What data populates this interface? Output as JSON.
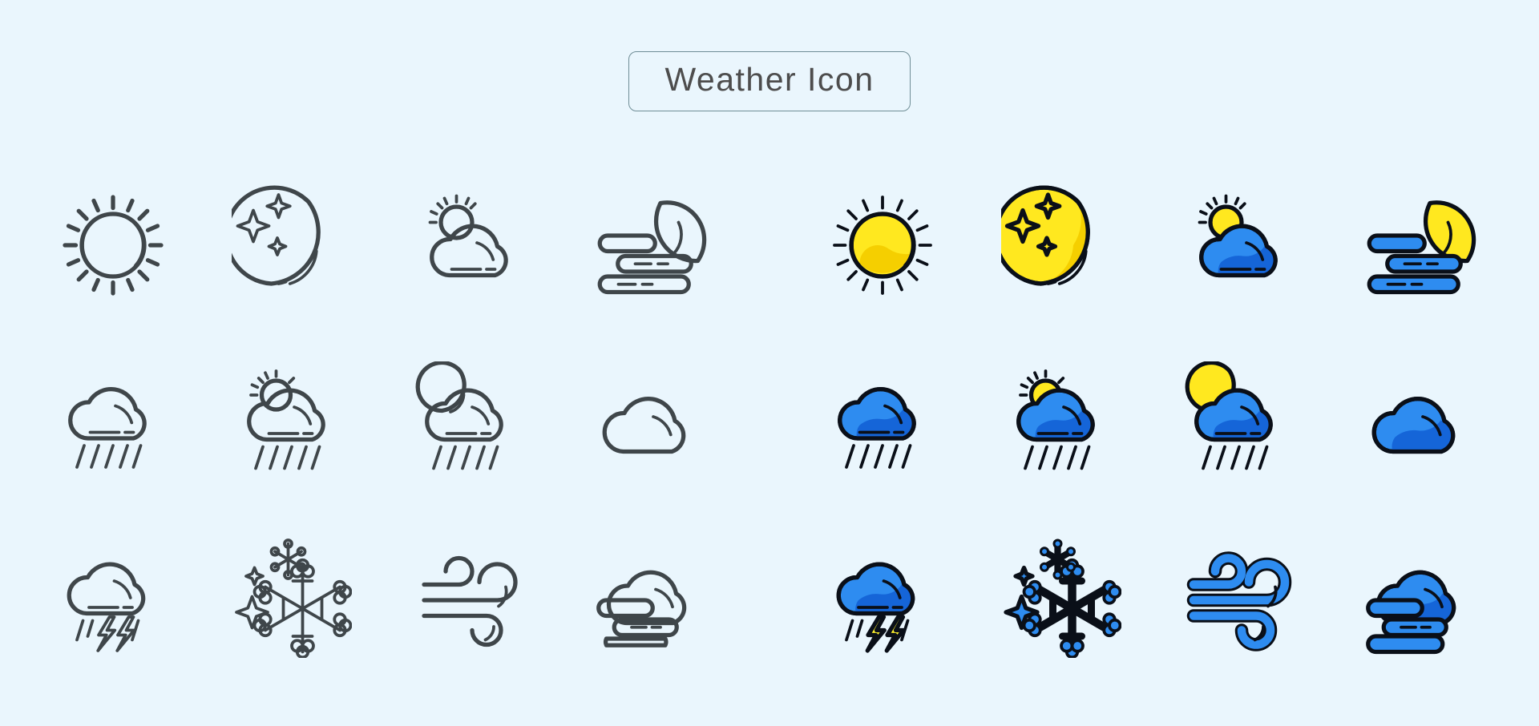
{
  "page": {
    "background_color": "#eaf6fd",
    "title": "Weather Icon"
  },
  "palette": {
    "background": "#eaf6fd",
    "outline_stroke": "#3f464a",
    "color_stroke": "#0a0f18",
    "sun_yellow": "#ffe81f",
    "sun_yellow_shade": "#f5cf00",
    "moon_yellow": "#ffe81f",
    "cloud_blue": "#2e8cf0",
    "cloud_blue_shade": "#1565d8",
    "snow_blue": "#2e8cf0",
    "lightning_yellow": "#fff22d",
    "title_border": "#6f8d96",
    "title_text": "#4d4d4d"
  },
  "sets": [
    {
      "name": "outline-set",
      "style": "outline"
    },
    {
      "name": "colored-set",
      "style": "colored"
    }
  ],
  "icons": [
    {
      "id": "sun",
      "label": "Sun",
      "row": 1,
      "col": 1
    },
    {
      "id": "moon-stars",
      "label": "Moon and Stars",
      "row": 1,
      "col": 2
    },
    {
      "id": "sun-cloud",
      "label": "Partly Cloudy",
      "row": 1,
      "col": 3
    },
    {
      "id": "moon-fog",
      "label": "Night Fog",
      "row": 1,
      "col": 4
    },
    {
      "id": "rain",
      "label": "Rain",
      "row": 2,
      "col": 1
    },
    {
      "id": "sun-rain",
      "label": "Day Rain",
      "row": 2,
      "col": 2
    },
    {
      "id": "moon-rain",
      "label": "Night Rain",
      "row": 2,
      "col": 3
    },
    {
      "id": "cloud",
      "label": "Cloudy",
      "row": 2,
      "col": 4
    },
    {
      "id": "thunderstorm",
      "label": "Thunderstorm",
      "row": 3,
      "col": 1
    },
    {
      "id": "snowflake",
      "label": "Snow",
      "row": 3,
      "col": 2
    },
    {
      "id": "wind",
      "label": "Wind",
      "row": 3,
      "col": 3
    },
    {
      "id": "fog",
      "label": "Fog",
      "row": 3,
      "col": 4
    }
  ]
}
